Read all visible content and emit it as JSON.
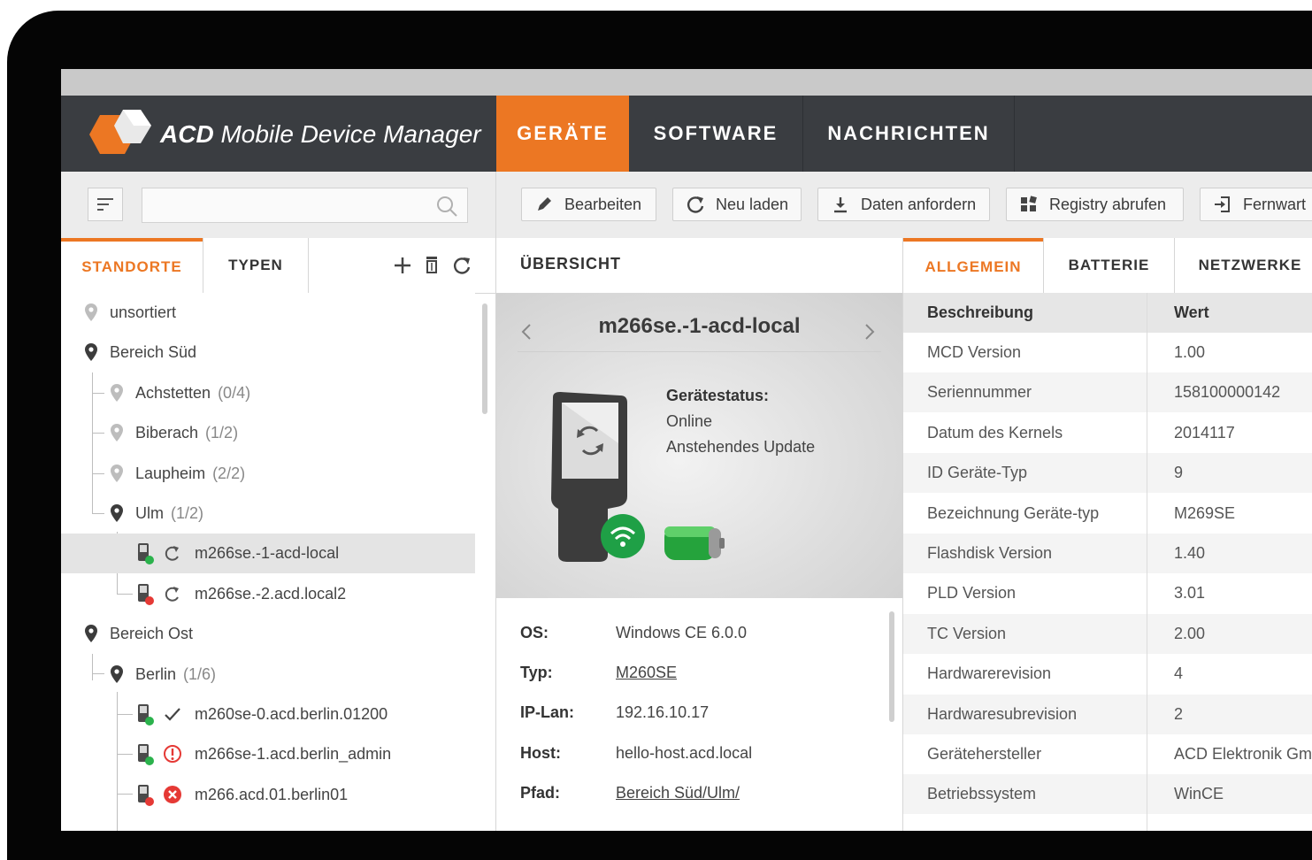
{
  "app": {
    "brand_bold": "ACD",
    "brand_rest": " Mobile Device Manager",
    "nav": [
      {
        "label": "GERÄTE",
        "active": true
      },
      {
        "label": "SOFTWARE",
        "active": false
      },
      {
        "label": "NACHRICHTEN",
        "active": false
      }
    ],
    "accent": "#ec7723",
    "header_bg": "#3a3d41"
  },
  "toolbar": {
    "search_placeholder": "",
    "buttons": [
      {
        "label": "Bearbeiten",
        "icon": "pencil-icon"
      },
      {
        "label": "Neu laden",
        "icon": "refresh-icon"
      },
      {
        "label": "Daten anfordern",
        "icon": "download-icon"
      },
      {
        "label": "Registry abrufen",
        "icon": "registry-icon"
      },
      {
        "label": "Fernwart",
        "icon": "remote-login-icon"
      }
    ]
  },
  "left_panel": {
    "tabs": [
      {
        "label": "STANDORTE",
        "active": true
      },
      {
        "label": "TYPEN",
        "active": false
      }
    ],
    "tree": [
      {
        "label": "unsortiert",
        "count": "",
        "level": 0,
        "kind": "location-light"
      },
      {
        "label": "Bereich Süd",
        "count": "",
        "level": 0,
        "kind": "location"
      },
      {
        "label": "Achstetten",
        "count": "(0/4)",
        "level": 1,
        "kind": "location-light"
      },
      {
        "label": "Biberach",
        "count": "(1/2)",
        "level": 1,
        "kind": "location-light"
      },
      {
        "label": "Laupheim",
        "count": "(2/2)",
        "level": 1,
        "kind": "location-light"
      },
      {
        "label": "Ulm",
        "count": "(1/2)",
        "level": 1,
        "kind": "location"
      },
      {
        "label": "m266se.-1-acd-local",
        "count": "",
        "level": 2,
        "kind": "device",
        "status_dot": "#2bb24c",
        "action": "sync",
        "selected": true
      },
      {
        "label": "m266se.-2.acd.local2",
        "count": "",
        "level": 2,
        "kind": "device",
        "status_dot": "#e53935",
        "action": "sync"
      },
      {
        "label": "Bereich Ost",
        "count": "",
        "level": 0,
        "kind": "location"
      },
      {
        "label": "Berlin",
        "count": "(1/6)",
        "level": 1,
        "kind": "location"
      },
      {
        "label": "m260se-0.acd.berlin.01200",
        "count": "",
        "level": 2,
        "kind": "device",
        "status_dot": "#2bb24c",
        "action": "check"
      },
      {
        "label": "m266se-1.acd.berlin_admin",
        "count": "",
        "level": 2,
        "kind": "device",
        "status_dot": "#2bb24c",
        "action": "warning"
      },
      {
        "label": "m266.acd.01.berlin01",
        "count": "",
        "level": 2,
        "kind": "device",
        "status_dot": "#e53935",
        "action": "error"
      }
    ]
  },
  "middle_panel": {
    "title": "ÜBERSICHT",
    "device_name": "m266se.-1-acd-local",
    "status_label": "Gerätestatus:",
    "status_lines": [
      "Online",
      "Anstehendes Update"
    ],
    "props": [
      {
        "key": "OS:",
        "value": "Windows CE 6.0.0",
        "link": false
      },
      {
        "key": "Typ:",
        "value": "M260SE",
        "link": true
      },
      {
        "key": "IP-Lan:",
        "value": "192.16.10.17",
        "link": false
      },
      {
        "key": "Host:",
        "value": "hello-host.acd.local",
        "link": false
      },
      {
        "key": "Pfad:",
        "value": "Bereich Süd/Ulm/",
        "link": true
      }
    ]
  },
  "right_panel": {
    "tabs": [
      {
        "label": "ALLGEMEIN",
        "active": true
      },
      {
        "label": "BATTERIE",
        "active": false
      },
      {
        "label": "NETZWERKE",
        "active": false
      }
    ],
    "columns": [
      "Beschreibung",
      "Wert"
    ],
    "rows": [
      [
        "MCD Version",
        "1.00"
      ],
      [
        "Seriennummer",
        "158100000142"
      ],
      [
        "Datum des Kernels",
        "2014117"
      ],
      [
        "ID Geräte-Typ",
        "9"
      ],
      [
        "Bezeichnung Geräte-typ",
        "M269SE"
      ],
      [
        "Flashdisk Version",
        "1.40"
      ],
      [
        "PLD Version",
        "3.01"
      ],
      [
        "TC Version",
        "2.00"
      ],
      [
        "Hardwarerevision",
        "4"
      ],
      [
        "Hardwaresubrevision",
        "2"
      ],
      [
        "Gerätehersteller",
        "ACD Elektronik Gmb"
      ],
      [
        "Betriebssystem",
        "WinCE"
      ]
    ]
  }
}
